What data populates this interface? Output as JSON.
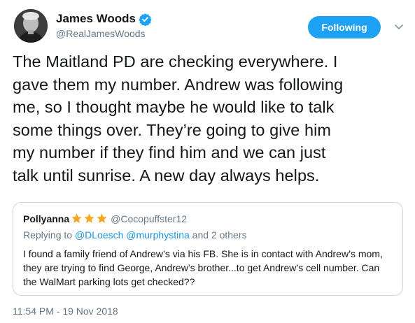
{
  "author": {
    "display_name": "James Woods",
    "handle": "@RealJamesWoods",
    "verified": true
  },
  "follow_button": {
    "label": "Following",
    "color": "#1da1f2"
  },
  "menu": {
    "icon": "chevron-down-icon"
  },
  "tweet": {
    "lines": [
      "The Maitland PD are checking everywhere. I",
      "gave them my number. Andrew was following",
      "me, so I thought maybe he would like to talk",
      "some things over. They’re going to give him",
      "my number if they find him and we can just",
      "talk until sunrise. A new day always helps."
    ],
    "timestamp": "11:54 PM - 19 Nov 2018"
  },
  "quoted": {
    "display_name": "Pollyanna",
    "stars": [
      "star-icon",
      "star-icon",
      "star-icon"
    ],
    "handle": "@Cocopuffster12",
    "reply_prefix": "Replying to ",
    "reply_users": "@DLoesch @murphystina",
    "reply_suffix": " and 2 others",
    "lines": [
      "I found a family friend of Andrew’s via his FB. She is in contact with Andrew’s mom,",
      "they are trying to find George, Andrew’s brother...to get Andrew’s cell number. Can",
      "the WalMart parking lots get checked??"
    ]
  },
  "colors": {
    "text": "#14171a",
    "secondary": "#657786",
    "link": "#1b95e0",
    "star": "#f5a623",
    "border": "#ccd6dd"
  }
}
